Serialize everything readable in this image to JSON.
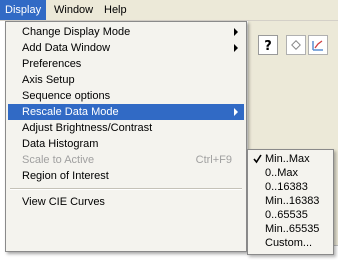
{
  "menubar": {
    "items": [
      {
        "label": "Display"
      },
      {
        "label": "Window"
      },
      {
        "label": "Help"
      }
    ]
  },
  "display_menu": {
    "items": [
      {
        "label": "Change Display Mode"
      },
      {
        "label": "Add Data Window"
      },
      {
        "label": "Preferences"
      },
      {
        "label": "Axis Setup"
      },
      {
        "label": "Sequence options"
      },
      {
        "label": "Rescale Data Mode"
      },
      {
        "label": "Adjust Brightness/Contrast"
      },
      {
        "label": "Data Histogram"
      },
      {
        "label": "Scale to Active",
        "shortcut": "Ctrl+F9"
      },
      {
        "label": "Region of Interest"
      },
      {
        "label": "View CIE Curves"
      }
    ]
  },
  "rescale_submenu": {
    "items": [
      {
        "label": "Min..Max"
      },
      {
        "label": "0..Max"
      },
      {
        "label": "0..16383"
      },
      {
        "label": "Min..16383"
      },
      {
        "label": "0..65535"
      },
      {
        "label": "Min..65535"
      },
      {
        "label": "Custom..."
      }
    ]
  },
  "colors": {
    "highlight": "#316ac5",
    "menu_bg": "#f4f3ee",
    "chrome_bg": "#ece9d8",
    "disabled_text": "#a0a0a0"
  },
  "icons": [
    "submenu-arrow-icon",
    "checkmark-icon",
    "help-question-icon",
    "diamond-icon",
    "chart-icon"
  ]
}
